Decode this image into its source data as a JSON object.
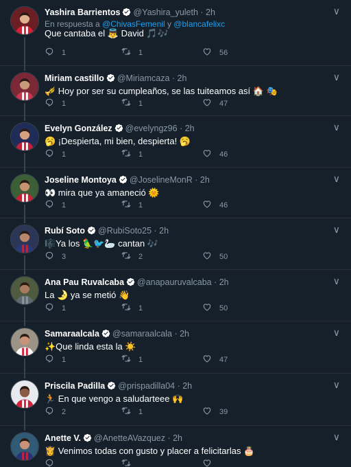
{
  "tweets": [
    {
      "name": "Yashira Barrientos",
      "handle": "@Yashira_yuleth",
      "time": "2h",
      "reply_prefix": "En respuesta a",
      "reply_mention1": "@ChivasFemenil",
      "reply_joiner": "y",
      "reply_mention2": "@blancafelixc",
      "text": "Que cantaba el 👼 David 🎵🎶",
      "replies": "1",
      "retweets": "1",
      "likes": "56"
    },
    {
      "name": "Miriam castillo",
      "handle": "@Miriamcaza",
      "time": "2h",
      "text": "🎺 Hoy por ser su cumpleaños, se las tuiteamos así 🏠 🎭",
      "replies": "1",
      "retweets": "1",
      "likes": "47"
    },
    {
      "name": "Evelyn González",
      "handle": "@evelyngz96",
      "time": "2h",
      "text": "🥱 ¡Despierta, mi bien, despierta! 🥱",
      "replies": "1",
      "retweets": "1",
      "likes": "46"
    },
    {
      "name": "Joseline Montoya",
      "handle": "@JoselineMonR",
      "time": "2h",
      "text": "👀 mira que ya amaneció 🌞",
      "replies": "1",
      "retweets": "1",
      "likes": "46"
    },
    {
      "name": "Rubí Soto",
      "handle": "@RubiSoto25",
      "time": "2h",
      "text": "🎼Ya los 🦜🐦🦢 cantan 🎶",
      "replies": "3",
      "retweets": "2",
      "likes": "50"
    },
    {
      "name": "Ana Pau Ruvalcaba",
      "handle": "@anapauruvalcaba",
      "time": "2h",
      "text": "La 🌛 ya se metió 👋",
      "replies": "1",
      "retweets": "1",
      "likes": "50"
    },
    {
      "name": "Samaraalcala",
      "handle": "@samaraalcala",
      "time": "2h",
      "text": "✨Que linda esta la ☀️",
      "replies": "1",
      "retweets": "1",
      "likes": "47"
    },
    {
      "name": "Priscila Padilla",
      "handle": "@prispadilla04",
      "time": "2h",
      "text": "🏃 En que vengo a saludarteee 🙌",
      "replies": "2",
      "retweets": "1",
      "likes": "39"
    },
    {
      "name": "Anette V.",
      "handle": "@AnetteAVazquez",
      "time": "2h",
      "text": "👸 Venimos todas con gusto y placer a felicitarlas 🎂",
      "replies": "",
      "retweets": "",
      "likes": ""
    }
  ],
  "colors": {
    "background": "#15202b",
    "muted": "#8899a6",
    "link": "#1da1f2",
    "verified": "#ffffff"
  },
  "icons": {
    "verified": "verified-badge-icon",
    "menu": "chevron-down-icon",
    "reply": "reply-icon",
    "retweet": "retweet-icon",
    "like": "heart-icon"
  }
}
